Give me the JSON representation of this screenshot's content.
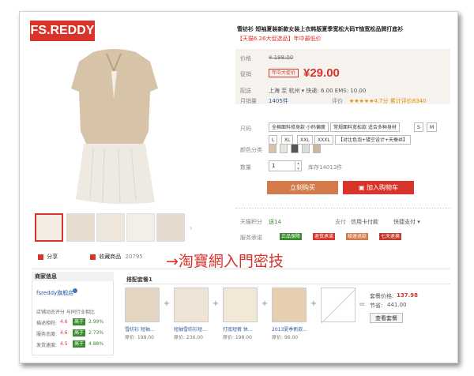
{
  "brand": {
    "logo_text": "FS.REDDY",
    "logo_bg": "#d9342b"
  },
  "product": {
    "title": "雪纺衫 短袖夏装新款女装上衣韩版夏季宽松大码T恤宽松品牌打底衫",
    "subtitle": "【天猫6.26大促选品】年中最低价",
    "price_label": "价格",
    "price_value": "¥ 198.00",
    "promo_label": "促销",
    "promo_badge": "年中大促价",
    "promo_price": "¥29.00",
    "shipping_label": "配送",
    "shipping_text": "上海 至 杭州 ▾  快递: 6.00 EMS: 10.00",
    "sales_label": "月销量",
    "sales_value": "1405件",
    "rating_label": "评价",
    "rating_text": "★★★★★4.7分 累计评价8340",
    "size_label": "尺码",
    "size_options": [
      "全棉面料修身款 小码偏瘦",
      "常规面料宽松款 适合多种身材",
      "S",
      "M"
    ],
    "size_options2": [
      "L",
      "XL",
      "XXL",
      "XXXL",
      "【对比色泡+镂空设计+天蚕丝】"
    ],
    "color_label": "颜色分类",
    "qty_label": "数量",
    "qty_value": "1",
    "stock_text": "库存14013件",
    "buy_now": "立刻购买",
    "add_cart": "加入购物车",
    "points_label": "天猫积分",
    "points_value": "送14",
    "pay_text": "支付",
    "credit_text": "信用卡付款",
    "express_text": "快捷支付 ▾",
    "service_label": "服务承诺",
    "service_items": [
      "正品保障",
      "退货承诺",
      "极速退款",
      "七天退换"
    ],
    "share": "分享",
    "collect": "收藏商品",
    "collect_count": "20795"
  },
  "overlay": {
    "text": "→淘寶網入門密技",
    "color": "#d9342b"
  },
  "shop": {
    "header": "商家信息",
    "name": "fsreddy旗舰店",
    "score_title": "店铺动态评分 与同行业相比",
    "scores": [
      {
        "label": "描述相符:",
        "value": "4.6",
        "compare": "高于",
        "pct": "2.99%"
      },
      {
        "label": "服务态度:",
        "value": "4.6",
        "compare": "高于",
        "pct": "2.73%"
      },
      {
        "label": "发货速度:",
        "value": "4.5",
        "compare": "高于",
        "pct": "4.88%"
      }
    ]
  },
  "combo": {
    "header": "搭配套餐1",
    "items": [
      {
        "name": "雪纺衫 短袖...",
        "price": "原价: 198.00"
      },
      {
        "name": "短袖雪纺衫短...",
        "price": "原价: 236.00"
      },
      {
        "name": "打底短裤 休...",
        "price": "原价: 198.00"
      },
      {
        "name": "2013夏季新款...",
        "price": "原价: 96.00"
      }
    ],
    "combo_price_label": "套餐价格:",
    "combo_price": "137.98",
    "save_label": "节省:",
    "save_value": "441.00",
    "view_button": "查看套餐"
  }
}
